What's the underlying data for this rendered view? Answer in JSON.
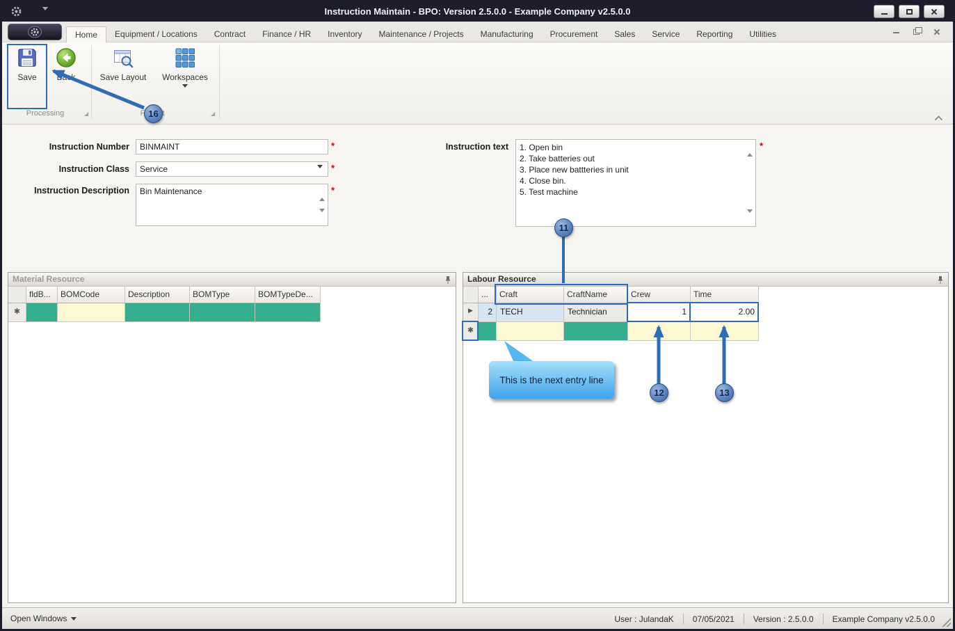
{
  "window": {
    "title": "Instruction Maintain - BPO: Version 2.5.0.0 - Example Company v2.5.0.0"
  },
  "ribbon": {
    "tabs": [
      {
        "label": "Home"
      },
      {
        "label": "Equipment / Locations"
      },
      {
        "label": "Contract"
      },
      {
        "label": "Finance / HR"
      },
      {
        "label": "Inventory"
      },
      {
        "label": "Maintenance / Projects"
      },
      {
        "label": "Manufacturing"
      },
      {
        "label": "Procurement"
      },
      {
        "label": "Sales"
      },
      {
        "label": "Service"
      },
      {
        "label": "Reporting"
      },
      {
        "label": "Utilities"
      }
    ],
    "buttons": {
      "save": "Save",
      "back": "Back",
      "save_layout": "Save Layout",
      "workspaces": "Workspaces"
    },
    "groups": {
      "processing": "Processing",
      "format": "Format"
    }
  },
  "form": {
    "required_marker": "*",
    "instruction_number": {
      "label": "Instruction Number",
      "value": "BINMAINT"
    },
    "instruction_class": {
      "label": "Instruction Class",
      "value": "Service"
    },
    "instruction_description": {
      "label": "Instruction Description",
      "value": "Bin Maintenance"
    },
    "instruction_text": {
      "label": "Instruction text",
      "lines": [
        "1. Open bin",
        "2. Take batteries out",
        "3. Place new battteries in unit",
        "4. Close bin.",
        "5. Test machine"
      ]
    }
  },
  "material_resource": {
    "title": "Material Resource",
    "columns": [
      "fldB...",
      "BOMCode",
      "Description",
      "BOMType",
      "BOMTypeDe..."
    ],
    "new_row_marker": "✱"
  },
  "labour_resource": {
    "title": "Labour Resource",
    "columns": [
      "...",
      "Craft",
      "CraftName",
      "Crew",
      "Time"
    ],
    "rows": [
      {
        "num": "2",
        "craft": "TECH",
        "craft_name": "Technician",
        "crew": "1",
        "time": "2.00"
      }
    ],
    "current_row_marker": "▶",
    "new_row_marker": "✱"
  },
  "annotations": {
    "callout_16": "16",
    "callout_11": "11",
    "callout_12": "12",
    "callout_13": "13",
    "tooltip_text": "This is the next entry line"
  },
  "status_bar": {
    "open_windows": "Open Windows",
    "user": "User : JulandaK",
    "date": "07/05/2021",
    "version": "Version : 2.5.0.0",
    "company": "Example Company v2.5.0.0"
  },
  "icons": {
    "dialog_launcher": "◢"
  },
  "colors": {
    "annotation_blue": "#2e6db5",
    "mandatory_teal": "#35ae8f",
    "editable_cream": "#fcf8d4"
  }
}
